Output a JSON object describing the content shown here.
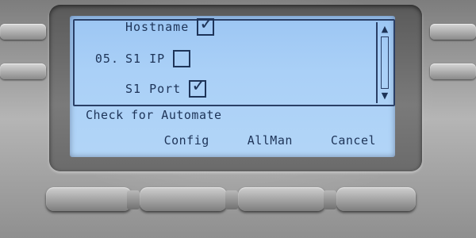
{
  "screen": {
    "rows": [
      {
        "number": "",
        "label": "Hostname",
        "checked": true
      },
      {
        "number": "05.",
        "label": "S1 IP",
        "checked": false
      },
      {
        "number": "",
        "label": "S1 Port",
        "checked": true
      }
    ],
    "check_glyph": "✓",
    "scroll_up_glyph": "▲",
    "scroll_down_glyph": "▼",
    "prompt": "Check for Automate"
  },
  "softkeys": {
    "config": "Config",
    "allman": "AllMan",
    "cancel": "Cancel"
  },
  "colors": {
    "lcd_background": "#aad0f7",
    "lcd_text": "#1e3458"
  }
}
